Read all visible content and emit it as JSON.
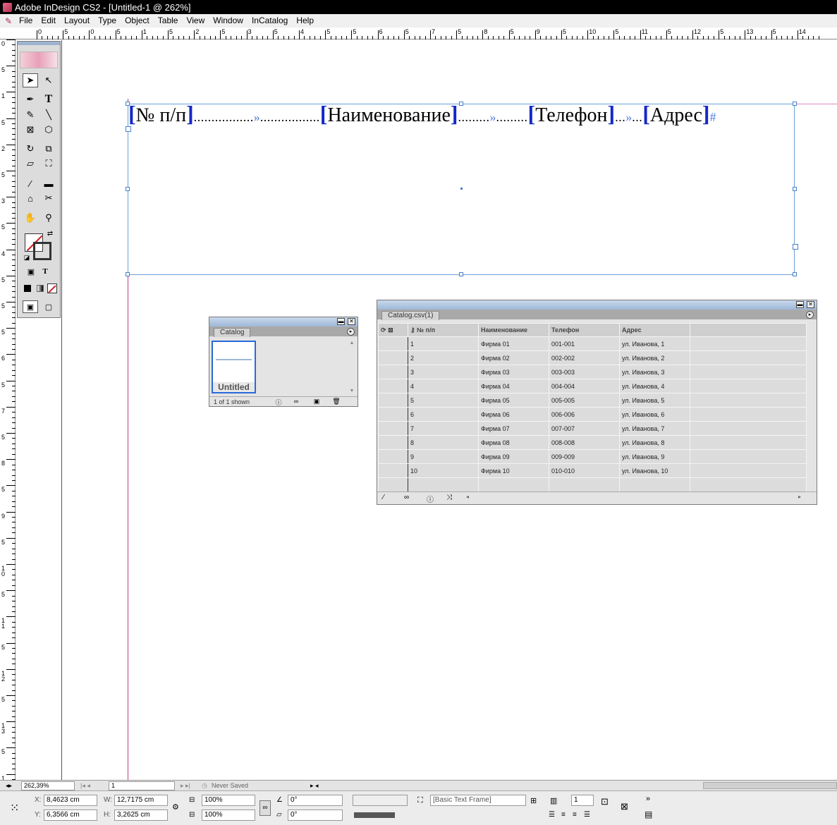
{
  "window": {
    "title": "Adobe InDesign CS2 - [Untitled-1 @ 262%]"
  },
  "menu": {
    "items": [
      "File",
      "Edit",
      "Layout",
      "Type",
      "Object",
      "Table",
      "View",
      "Window",
      "InCatalog",
      "Help"
    ]
  },
  "ruler": {
    "h_labels": [
      "0",
      "5",
      "0",
      "5",
      "1",
      "5",
      "2",
      "5",
      "3",
      "5",
      "4",
      "5",
      "5",
      "6",
      "5",
      "7",
      "5",
      "8",
      "5",
      "9",
      "5",
      "10",
      "5",
      "11",
      "5",
      "12",
      "5",
      "13",
      "5",
      "14"
    ],
    "v_labels": [
      "0",
      "5",
      "1",
      "5",
      "2",
      "5",
      "3",
      "5",
      "4",
      "5",
      "5",
      "5",
      "6",
      "5",
      "7",
      "5",
      "8",
      "5",
      "9",
      "5",
      "1 0",
      "5",
      "1 1",
      "5",
      "1 2",
      "5",
      "1 3",
      "5",
      "1 4",
      "5"
    ]
  },
  "document": {
    "frame_text": {
      "field1": "№ п/п",
      "field2": "Наименование",
      "field3": "Телефон",
      "field4": "Адрес",
      "tab_arrow": "»",
      "end_mark": "#"
    }
  },
  "catalog_panel": {
    "tab": "Catalog",
    "thumb_label": "Untitled",
    "status": "1 of 1 shown"
  },
  "csv_panel": {
    "tab": "Catalog.csv(1)",
    "headers": [
      "№ п/п",
      "Наименование",
      "Телефон",
      "Адрес"
    ],
    "rows": [
      [
        "1",
        "Фирма 01",
        "001-001",
        "ул. Иванова, 1"
      ],
      [
        "2",
        "Фирма 02",
        "002-002",
        "ул. Иванова, 2"
      ],
      [
        "3",
        "Фирма 03",
        "003-003",
        "ул. Иванова, 3"
      ],
      [
        "4",
        "Фирма 04",
        "004-004",
        "ул. Иванова, 4"
      ],
      [
        "5",
        "Фирма 05",
        "005-005",
        "ул. Иванова, 5"
      ],
      [
        "6",
        "Фирма 06",
        "006-006",
        "ул. Иванова, 6"
      ],
      [
        "7",
        "Фирма 07",
        "007-007",
        "ул. Иванова, 7"
      ],
      [
        "8",
        "Фирма 08",
        "008-008",
        "ул. Иванова, 8"
      ],
      [
        "9",
        "Фирма 09",
        "009-009",
        "ул. Иванова, 9"
      ],
      [
        "10",
        "Фирма 10",
        "010-010",
        "ул. Иванова, 10"
      ]
    ]
  },
  "statusbar": {
    "zoom": "262,39%",
    "page": "1",
    "save_state": "Never Saved"
  },
  "control": {
    "x_label": "X:",
    "x_value": "8,4623 cm",
    "y_label": "Y:",
    "y_value": "6,3566 cm",
    "w_label": "W:",
    "w_value": "12,7175 cm",
    "h_label": "H:",
    "h_value": "3,2625 cm",
    "scale_x": "100%",
    "scale_y": "100%",
    "rotate": "0°",
    "shear": "0°",
    "object_style": "[Basic Text Frame]",
    "columns": "1",
    "more": "»"
  },
  "colors": {
    "accent": "#4a7ec8",
    "margin": "#c63c8c",
    "bracket": "#1428c8"
  }
}
